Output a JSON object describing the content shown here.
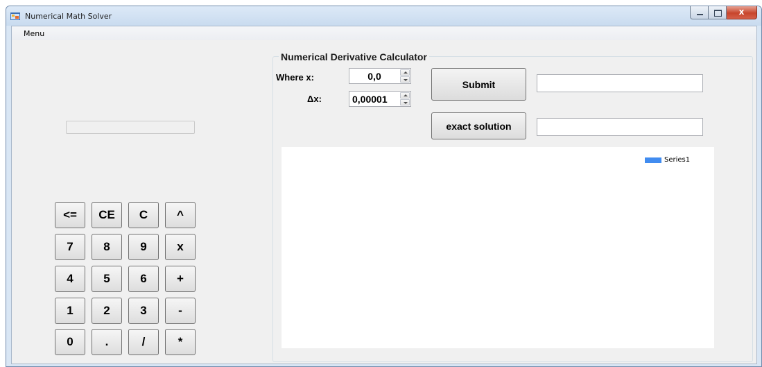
{
  "window": {
    "title": "Numerical Math Solver",
    "close_glyph": "x"
  },
  "menu": {
    "label": "Menu"
  },
  "calculator": {
    "display_value": "",
    "buttons": [
      "<=",
      "CE",
      "C",
      "^",
      "7",
      "8",
      "9",
      "x",
      "4",
      "5",
      "6",
      "+",
      "1",
      "2",
      "3",
      "-",
      "0",
      ".",
      "/",
      "*"
    ]
  },
  "derivative": {
    "group_title": "Numerical Derivative Calculator",
    "where_x_label": "Where x:",
    "where_x_value": "0,0",
    "delta_x_label": "Δx:",
    "delta_x_value": "0,00001",
    "submit_label": "Submit",
    "submit_result": "",
    "exact_label": "exact solution",
    "exact_result": ""
  },
  "chart": {
    "legend_series": "Series1",
    "series_color": "#418cf0"
  }
}
